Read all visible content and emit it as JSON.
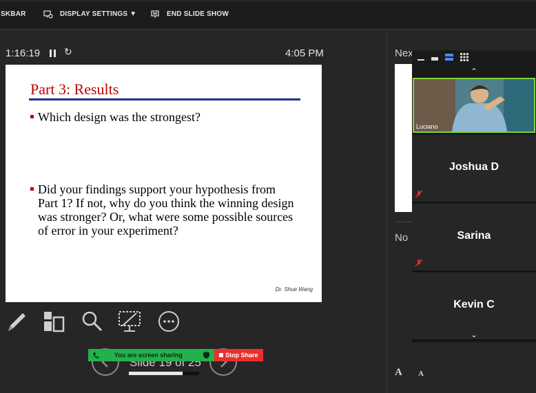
{
  "topbar": {
    "taskbar_label": "SKBAR",
    "display_settings_label": "DISPLAY SETTINGS ▼",
    "end_slide_show_label": "END SLIDE SHOW"
  },
  "presenter": {
    "elapsed": "1:16:19",
    "clock": "4:05 PM",
    "next_label": "Nex",
    "notes_label": "No",
    "font_larger": "A",
    "font_smaller": "A"
  },
  "slide": {
    "title": "Part 3: Results",
    "bullets": [
      "Which design was the strongest?",
      "Did your findings support your hypothesis from Part 1? If not, why do you think the winning design was stronger? Or, what were some possible sources of error in your experiment?"
    ],
    "footer": "Dr. Shue Wang"
  },
  "navigation": {
    "slide_counter": "Slide 19 of 25",
    "progress": 0.76
  },
  "sharing": {
    "status": "You are screen sharing",
    "stop_label": "Stop Share"
  },
  "zoom": {
    "participants": [
      {
        "name": "Luciano",
        "video": true
      },
      {
        "name": "Joshua D",
        "video": false,
        "muted": true
      },
      {
        "name": "Sarina",
        "video": false,
        "muted": true
      },
      {
        "name": "Kevin C",
        "video": false,
        "muted": true
      }
    ]
  },
  "colors": {
    "slide_title": "#c00000",
    "slide_rule": "#1f2f8f",
    "share_green": "#22b14c",
    "stop_red": "#e8312f",
    "active_speaker": "#7ed43f",
    "mute_red": "#d9302c"
  },
  "icons": {
    "tools": [
      "pen-icon",
      "see-all-slides-icon",
      "zoom-icon",
      "black-screen-icon",
      "more-options-icon"
    ]
  }
}
